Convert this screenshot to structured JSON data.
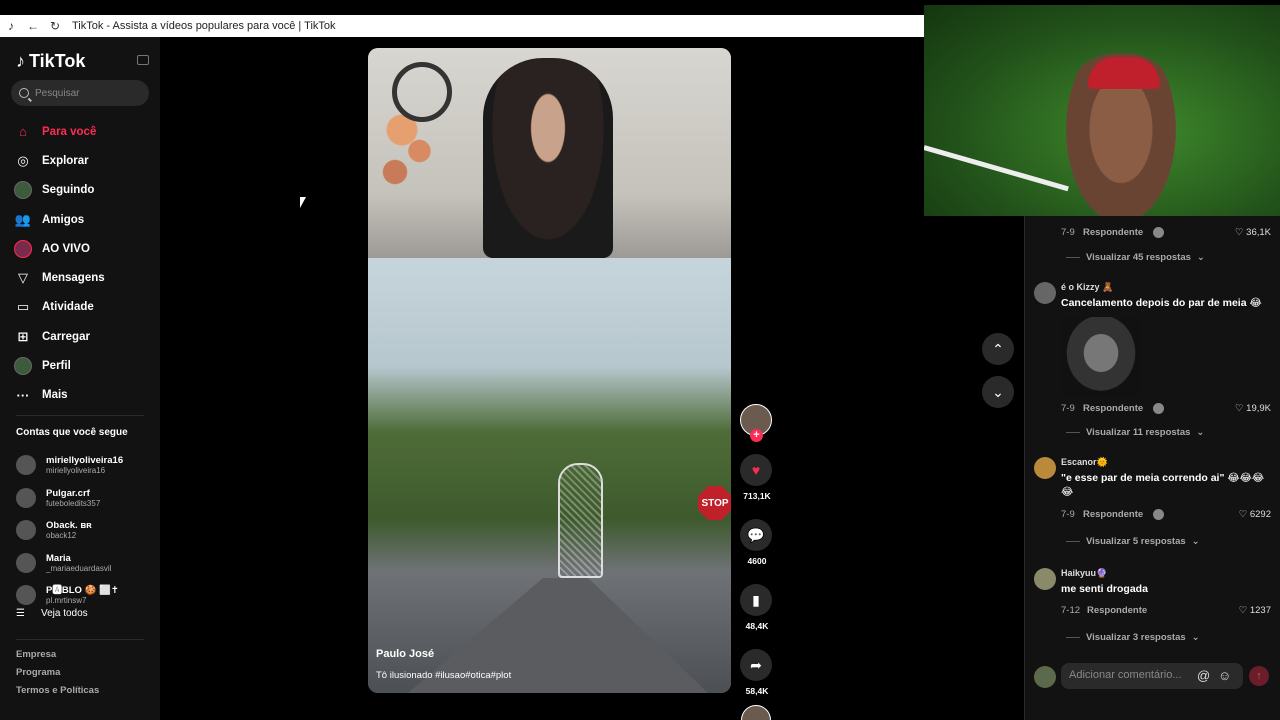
{
  "browser": {
    "title": "TikTok - Assista a vídeos populares para você | TikTok"
  },
  "sidebar": {
    "logo": "TikTok",
    "search_placeholder": "Pesquisar",
    "nav": [
      {
        "label": "Para você",
        "icon": "home-icon"
      },
      {
        "label": "Explorar",
        "icon": "compass-icon"
      },
      {
        "label": "Seguindo",
        "icon": "following-avatar-icon"
      },
      {
        "label": "Amigos",
        "icon": "friends-icon"
      },
      {
        "label": "AO VIVO",
        "icon": "live-icon"
      },
      {
        "label": "Mensagens",
        "icon": "send-icon"
      },
      {
        "label": "Atividade",
        "icon": "activity-icon"
      },
      {
        "label": "Carregar",
        "icon": "upload-icon"
      },
      {
        "label": "Perfil",
        "icon": "profile-icon"
      },
      {
        "label": "Mais",
        "icon": "more-icon"
      }
    ],
    "following_title": "Contas que você segue",
    "following": [
      {
        "name": "miriellyoliveira16",
        "handle": "miriellyoliveira16"
      },
      {
        "name": "Pulgar.crf",
        "handle": "futeboledits357"
      },
      {
        "name": "Oback. ʙʀ",
        "handle": "oback12"
      },
      {
        "name": "Maria",
        "handle": "_mariaeduardasvil"
      },
      {
        "name": "P🅰BLO 🍪 ⬜✝",
        "handle": "pl.mrtinsw7"
      }
    ],
    "see_all": "Veja todos",
    "footer": [
      "Empresa",
      "Programa",
      "Termos e Políticas"
    ]
  },
  "video": {
    "author": "Paulo José",
    "caption": "Tô ilusionado #ilusao#otica#plot",
    "stop_sign": "STOP",
    "likes": "713,1K",
    "comments": "4600",
    "saves": "48,4K",
    "shares": "58,4K"
  },
  "comments": [
    {
      "date": "7-9",
      "reply": "Respondente",
      "likes": "36,1K",
      "more": "Visualizar 45 respostas"
    },
    {
      "user": "é o Kizzy 🧸",
      "text": "Cancelamento depois do par de meia 😂",
      "date": "7-9",
      "reply": "Respondente",
      "likes": "19,9K",
      "more": "Visualizar 11 respostas"
    },
    {
      "user": "Escanor🌞",
      "text": "\"e esse par de meia correndo ai\" 😂😂😂😂",
      "date": "7-9",
      "reply": "Respondente",
      "likes": "6292",
      "more": "Visualizar 5 respostas"
    },
    {
      "user": "Haikyuu🔮",
      "text": "me senti drogada",
      "date": "7-12",
      "reply": "Respondente",
      "likes": "1237",
      "more": "Visualizar 3 respostas"
    }
  ],
  "add_comment_placeholder": "Adicionar comentário..."
}
